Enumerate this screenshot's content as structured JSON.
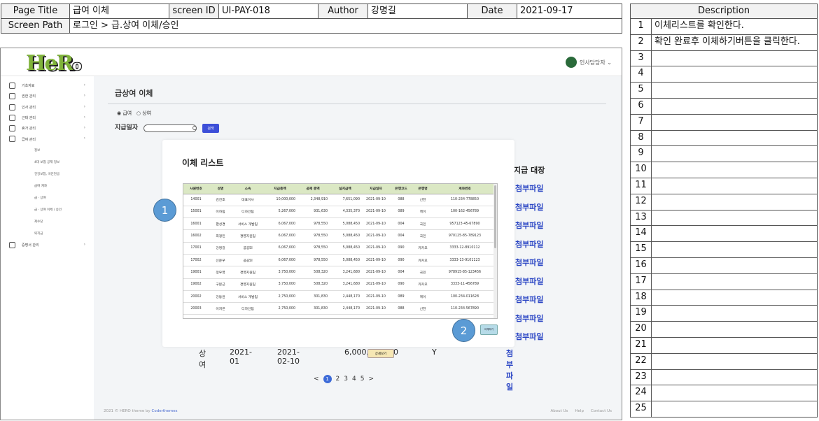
{
  "header": {
    "page_title_label": "Page Title",
    "page_title_value": "급여 이체",
    "screen_id_label": "screen ID",
    "screen_id_value": "UI-PAY-018",
    "author_label": "Author",
    "author_value": "강명길",
    "date_label": "Date",
    "date_value": "2021-09-17",
    "screen_path_label": "Screen Path",
    "screen_path_value": "로그인 > 급.상여 이체/승인"
  },
  "description": {
    "title": "Description",
    "rows": [
      {
        "n": "1",
        "text": "이체리스트를 확인한다."
      },
      {
        "n": "2",
        "text": "확인 완료후 이체하기버튼을 클릭한다."
      },
      {
        "n": "3",
        "text": ""
      },
      {
        "n": "4",
        "text": ""
      },
      {
        "n": "5",
        "text": ""
      },
      {
        "n": "6",
        "text": ""
      },
      {
        "n": "7",
        "text": ""
      },
      {
        "n": "8",
        "text": ""
      },
      {
        "n": "9",
        "text": ""
      },
      {
        "n": "10",
        "text": ""
      },
      {
        "n": "11",
        "text": ""
      },
      {
        "n": "12",
        "text": ""
      },
      {
        "n": "13",
        "text": ""
      },
      {
        "n": "14",
        "text": ""
      },
      {
        "n": "15",
        "text": ""
      },
      {
        "n": "16",
        "text": ""
      },
      {
        "n": "17",
        "text": ""
      },
      {
        "n": "18",
        "text": ""
      },
      {
        "n": "19",
        "text": ""
      },
      {
        "n": "20",
        "text": ""
      },
      {
        "n": "21",
        "text": ""
      },
      {
        "n": "22",
        "text": ""
      },
      {
        "n": "23",
        "text": ""
      },
      {
        "n": "24",
        "text": ""
      },
      {
        "n": "25",
        "text": ""
      }
    ]
  },
  "app": {
    "logo_main": "HeR",
    "logo_small": "o",
    "user_name": "인사담당자 ⌄",
    "sidebar": [
      {
        "label": "기초자료",
        "icon": "mail-icon"
      },
      {
        "label": "권한 관리",
        "icon": "warning-icon"
      },
      {
        "label": "인사 관리",
        "icon": "briefcase-icon"
      },
      {
        "label": "근태 관리",
        "icon": "document-icon"
      },
      {
        "label": "휴가 관리",
        "icon": "bookmark-icon"
      },
      {
        "label": "급여 관리",
        "icon": "globe-icon"
      }
    ],
    "subitems": [
      "정보",
      "4대 보험 공제 정보",
      "건강보험, 국민연금",
      "급여 계좌",
      "급 · 상여",
      "급 · 상여 이체 / 승인",
      "제수당",
      "퇴직금"
    ],
    "last_item": {
      "label": "증명서 관리",
      "icon": "print-icon"
    },
    "page_title": "급상여 이체",
    "radio_salary": "◉ 급여",
    "radio_bonus": "○ 상여",
    "date_label": "지급일자",
    "search_btn": "검색",
    "behind_header": "지급 대장",
    "attach_link": "첨부파일",
    "bonus_row": {
      "type": "상여",
      "month": "2021-01",
      "date": "2021-02-10",
      "amount": "6,000,000",
      "count": "20",
      "flag": "Y",
      "detail": "상세보기",
      "attach": "첨부파일"
    },
    "pager": {
      "prev": "<",
      "pages": [
        "1",
        "2",
        "3",
        "4",
        "5"
      ],
      "next": ">"
    },
    "footer_left": "2021 © HERO theme by ",
    "footer_link": "Coderthemes",
    "footer_right": [
      "About Us",
      "Help",
      "Contact Us"
    ]
  },
  "modal": {
    "title": "이체 리스트",
    "columns": [
      "사원번호",
      "성명",
      "소속",
      "지급총액",
      "공제 총액",
      "실지급액",
      "지급일자",
      "은행코드",
      "은행명",
      "계좌번호"
    ],
    "rows": [
      [
        "14001",
        "김진호",
        "대표이사",
        "10,000,000",
        "2,348,910",
        "7,651,090",
        "2021-09-10",
        "088",
        "신한",
        "110-234-778850"
      ],
      [
        "15001",
        "이하림",
        "디자인팀",
        "5,267,000",
        "931,630",
        "4,335,370",
        "2021-09-10",
        "089",
        "케이",
        "100-162-456789"
      ],
      [
        "16001",
        "편성경",
        "서비스 개발팀",
        "6,067,000",
        "978,550",
        "5,088,450",
        "2021-09-10",
        "004",
        "국민",
        "957123-45-67890"
      ],
      [
        "16002",
        "최정민",
        "경영지원팀",
        "6,067,000",
        "978,550",
        "5,088,450",
        "2021-09-10",
        "004",
        "국민",
        "970125-85-789123"
      ],
      [
        "17001",
        "강명길",
        "공공SI",
        "6,067,000",
        "978,550",
        "5,088,450",
        "2021-09-10",
        "090",
        "카카오",
        "3333-12-8910112"
      ],
      [
        "17002",
        "신윤우",
        "공공SI",
        "6,067,000",
        "978,550",
        "5,088,450",
        "2021-09-10",
        "090",
        "카카오",
        "3333-13-9101123"
      ],
      [
        "19001",
        "정우영",
        "경영지원팀",
        "3,750,000",
        "508,320",
        "3,241,680",
        "2021-09-10",
        "004",
        "국민",
        "978915-85-123456"
      ],
      [
        "19002",
        "구본근",
        "경영지원팀",
        "3,750,000",
        "508,320",
        "3,241,680",
        "2021-09-10",
        "090",
        "카카오",
        "3333-11-456789"
      ],
      [
        "20002",
        "강동원",
        "서비스 개발팀",
        "2,750,000",
        "301,830",
        "2,448,170",
        "2021-09-10",
        "089",
        "케이",
        "100-234-011628"
      ],
      [
        "20003",
        "이지은",
        "디자인팀",
        "2,750,000",
        "301,830",
        "2,448,170",
        "2021-09-10",
        "088",
        "신한",
        "110-234-567890"
      ]
    ],
    "transfer_btn": "이체하기"
  },
  "callouts": [
    "1",
    "2"
  ]
}
